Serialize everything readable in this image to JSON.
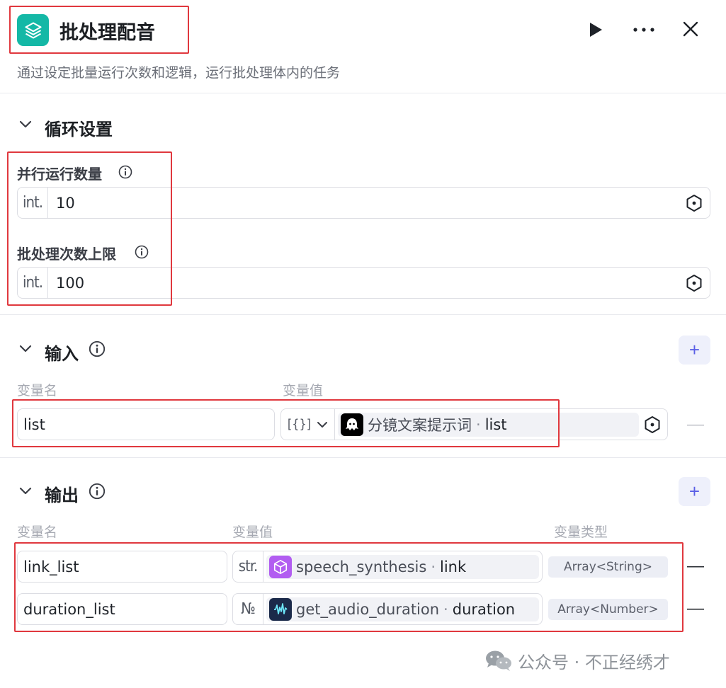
{
  "header": {
    "title": "批处理配音",
    "description": "通过设定批量运行次数和逻辑，运行批处理体内的任务"
  },
  "loop_settings": {
    "section_title": "循环设置",
    "parallel": {
      "label": "并行运行数量",
      "type": "int.",
      "value": "10"
    },
    "limit": {
      "label": "批处理次数上限",
      "type": "int.",
      "value": "100"
    }
  },
  "input": {
    "section_title": "输入",
    "col_name": "变量名",
    "col_value": "变量值",
    "rows": [
      {
        "name": "list",
        "type_symbol": "[{}]",
        "node": "分镜文案提示词",
        "sep": "·",
        "var": "list"
      }
    ]
  },
  "output": {
    "section_title": "输出",
    "col_name": "变量名",
    "col_value": "变量值",
    "col_type": "变量类型",
    "rows": [
      {
        "name": "link_list",
        "type_symbol": "str.",
        "node": "speech_synthesis",
        "sep": "·",
        "var": "link",
        "var_type": "Array<String>",
        "icon_color": "#b25df1"
      },
      {
        "name": "duration_list",
        "type_symbol": "№",
        "node": "get_audio_duration",
        "sep": "·",
        "var": "duration",
        "var_type": "Array<Number>",
        "icon_color": "#1b2a4a"
      }
    ]
  },
  "plus_symbol": "+",
  "minus_symbol": "—",
  "watermark": "公众号 · 不正经绣才",
  "colors": {
    "accent": "#5a5fe6",
    "app_icon": "#14b8a6",
    "highlight": "#e0383e"
  },
  "icons": [
    "layers-icon",
    "play-icon",
    "more-icon",
    "close-icon",
    "chevron-down-icon",
    "info-icon",
    "hexagon-icon",
    "ghost-icon",
    "cube-icon",
    "audio-icon",
    "wechat-icon"
  ]
}
